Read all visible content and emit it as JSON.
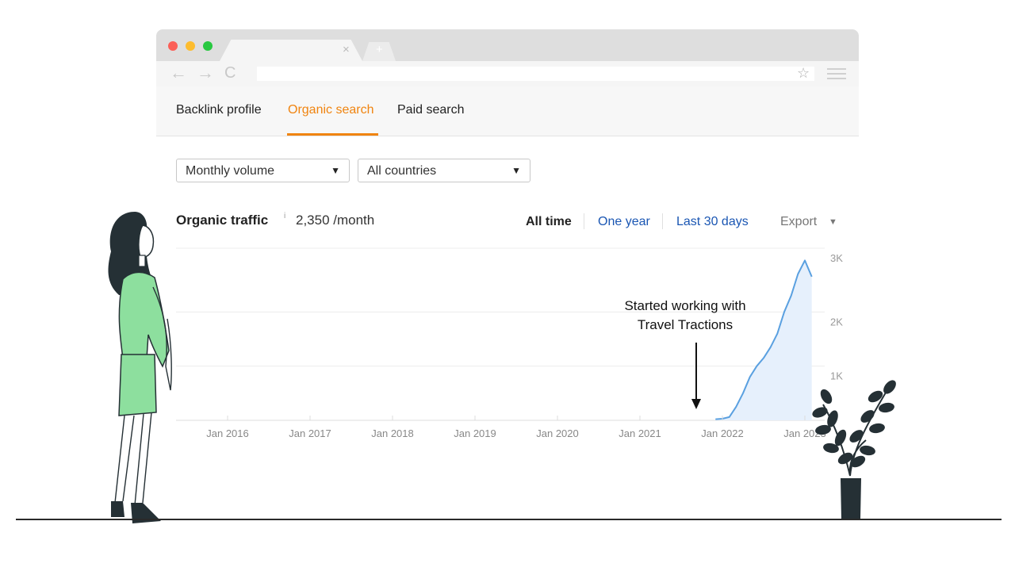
{
  "browser": {
    "tab_close": "×",
    "tab_new": "+",
    "url": "",
    "nav_back": "←",
    "nav_forward": "→",
    "nav_reload": "C",
    "star": "☆"
  },
  "nav": {
    "tabs": [
      {
        "label": "Backlink profile"
      },
      {
        "label": "Organic search",
        "active": true
      },
      {
        "label": "Paid search"
      }
    ]
  },
  "filters": {
    "volume": {
      "value": "Monthly volume",
      "caret": "▼"
    },
    "country": {
      "value": "All countries",
      "caret": "▼"
    }
  },
  "metric": {
    "title": "Organic traffic",
    "info": "i",
    "value": "2,350 /month"
  },
  "ranges": [
    {
      "label": "All time",
      "selected": true
    },
    {
      "label": "One year"
    },
    {
      "label": "Last 30 days"
    }
  ],
  "export": {
    "label": "Export",
    "caret": "▼"
  },
  "colors": {
    "accent": "#f08410",
    "link": "#1a56b3",
    "line": "#5aa0e0",
    "area": "#e6f0fc"
  },
  "chart_data": {
    "type": "area",
    "y_ticks": [
      "3K",
      "2K",
      "1K"
    ],
    "ylim": [
      0,
      3000
    ],
    "x_ticks": [
      "Jan 2016",
      "Jan 2017",
      "Jan 2018",
      "Jan 2019",
      "Jan 2020",
      "Jan 2021",
      "Jan 2022",
      "Jan 2023"
    ],
    "annotation": "Started working with\nTravel Tractions",
    "annotation_x": "2021-11",
    "series": [
      {
        "x": [
          "2021-12",
          "2022-01",
          "2022-02",
          "2022-03",
          "2022-04",
          "2022-05",
          "2022-06",
          "2022-07",
          "2022-08",
          "2022-09",
          "2022-10",
          "2022-11",
          "2022-12",
          "2023-01",
          "2023-02"
        ],
        "values": [
          20,
          30,
          60,
          250,
          500,
          800,
          1000,
          1150,
          1350,
          1600,
          2000,
          2300,
          2700,
          2950,
          2650
        ]
      }
    ]
  }
}
